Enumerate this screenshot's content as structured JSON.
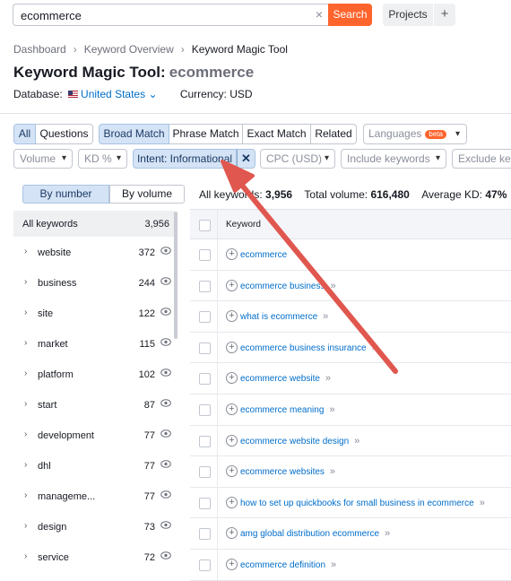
{
  "search": {
    "value": "ecommerce",
    "clear_icon": "×",
    "search_label": "Search",
    "projects_label": "Projects",
    "plus_label": "+"
  },
  "breadcrumb": {
    "items": [
      "Dashboard",
      "Keyword Overview",
      "Keyword Magic Tool"
    ],
    "separator": "›"
  },
  "title": {
    "main": "Keyword Magic Tool:",
    "keyword": "ecommerce"
  },
  "database": {
    "label": "Database:",
    "country": "United States",
    "currency": "Currency: USD"
  },
  "match_tabs": [
    "All",
    "Questions",
    "Broad Match",
    "Phrase Match",
    "Exact Match",
    "Related"
  ],
  "languages": {
    "label": "Languages",
    "badge": "beta"
  },
  "filters": {
    "volume": "Volume",
    "kd": "KD %",
    "intent": "Intent: Informational",
    "cpc": "CPC (USD)",
    "include": "Include keywords",
    "exclude": "Exclude key"
  },
  "group_toggle": {
    "by_number": "By number",
    "by_volume": "By volume"
  },
  "all_keywords": {
    "label": "All keywords",
    "count": "3,956"
  },
  "groups": [
    {
      "name": "website",
      "count": "372"
    },
    {
      "name": "business",
      "count": "244"
    },
    {
      "name": "site",
      "count": "122"
    },
    {
      "name": "market",
      "count": "115"
    },
    {
      "name": "platform",
      "count": "102"
    },
    {
      "name": "start",
      "count": "87"
    },
    {
      "name": "development",
      "count": "77"
    },
    {
      "name": "dhl",
      "count": "77"
    },
    {
      "name": "manageme...",
      "count": "77"
    },
    {
      "name": "design",
      "count": "73"
    },
    {
      "name": "service",
      "count": "72"
    }
  ],
  "summary": {
    "all_label": "All keywords:",
    "all_value": "3,956",
    "volume_label": "Total volume:",
    "volume_value": "616,480",
    "kd_label": "Average KD:",
    "kd_value": "47%"
  },
  "table": {
    "header": "Keyword",
    "rows": [
      {
        "keyword": "ecommerce",
        "arrows": ""
      },
      {
        "keyword": "ecommerce business",
        "arrows": "»"
      },
      {
        "keyword": "what is ecommerce",
        "arrows": "»"
      },
      {
        "keyword": "ecommerce business insurance",
        "arrows": "»"
      },
      {
        "keyword": "ecommerce website",
        "arrows": "»"
      },
      {
        "keyword": "ecommerce meaning",
        "arrows": "»"
      },
      {
        "keyword": "ecommerce website design",
        "arrows": "»"
      },
      {
        "keyword": "ecommerce websites",
        "arrows": "»"
      },
      {
        "keyword": "how to set up quickbooks for small business in ecommerce",
        "arrows": "»"
      },
      {
        "keyword": "amg global distribution ecommerce",
        "arrows": "»"
      },
      {
        "keyword": "ecommerce definition",
        "arrows": "»"
      }
    ]
  },
  "colors": {
    "accent": "#ff642d",
    "link": "#006dca",
    "active_bg": "#d4e3f5",
    "annotation_arrow": "#e0574f"
  }
}
